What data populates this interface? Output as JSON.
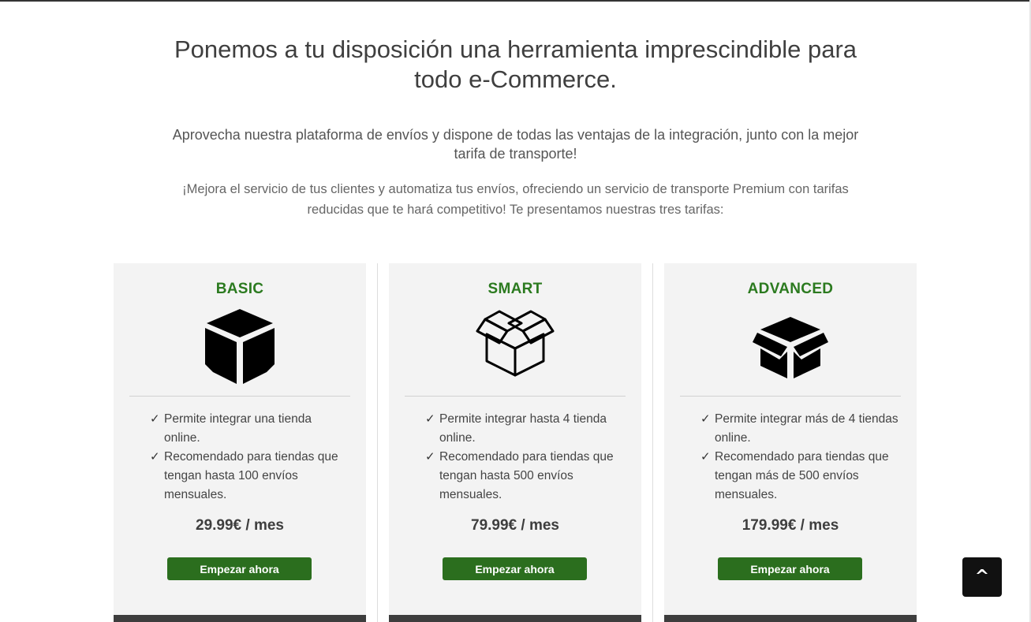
{
  "hero": {
    "title": "Ponemos a tu disposición una herramienta imprescindible para todo e-Commerce.",
    "subtitle": "Aprovecha nuestra plataforma de envíos y dispone de todas las ventajas de la integración, junto con la mejor tarifa de transporte!",
    "intro": "¡Mejora el servicio de tus clientes y automatiza tus envíos, ofreciendo un servicio de transporte Premium con tarifas reducidas que te hará competitivo! Te presentamos nuestras tres tarifas:"
  },
  "plans": [
    {
      "name": "BASIC",
      "icon": "solid-box-icon",
      "features": [
        "Permite integrar una tienda online.",
        "Recomendado para tiendas que tengan hasta 100 envíos mensuales."
      ],
      "price": "29.99€ / mes",
      "cta": "Empezar ahora"
    },
    {
      "name": "SMART",
      "icon": "open-box-outline-icon",
      "features": [
        "Permite integrar hasta 4 tienda online.",
        "Recomendado para tiendas que tengan hasta 500 envíos mensuales."
      ],
      "price": "79.99€ / mes",
      "cta": "Empezar ahora"
    },
    {
      "name": "ADVANCED",
      "icon": "open-box-solid-icon",
      "features": [
        "Permite integrar más de 4 tiendas online.",
        "Recomendado para tiendas que tengan más de 500 envíos mensuales."
      ],
      "price": "179.99€ / mes",
      "cta": "Empezar ahora"
    }
  ],
  "check_glyph": "✓",
  "back_to_top": "^",
  "colors": {
    "accent_green": "#2b7a1f",
    "button_green": "#2b6e1e",
    "card_bg": "#f3f3f3",
    "card_bar": "#3d3d3d"
  }
}
